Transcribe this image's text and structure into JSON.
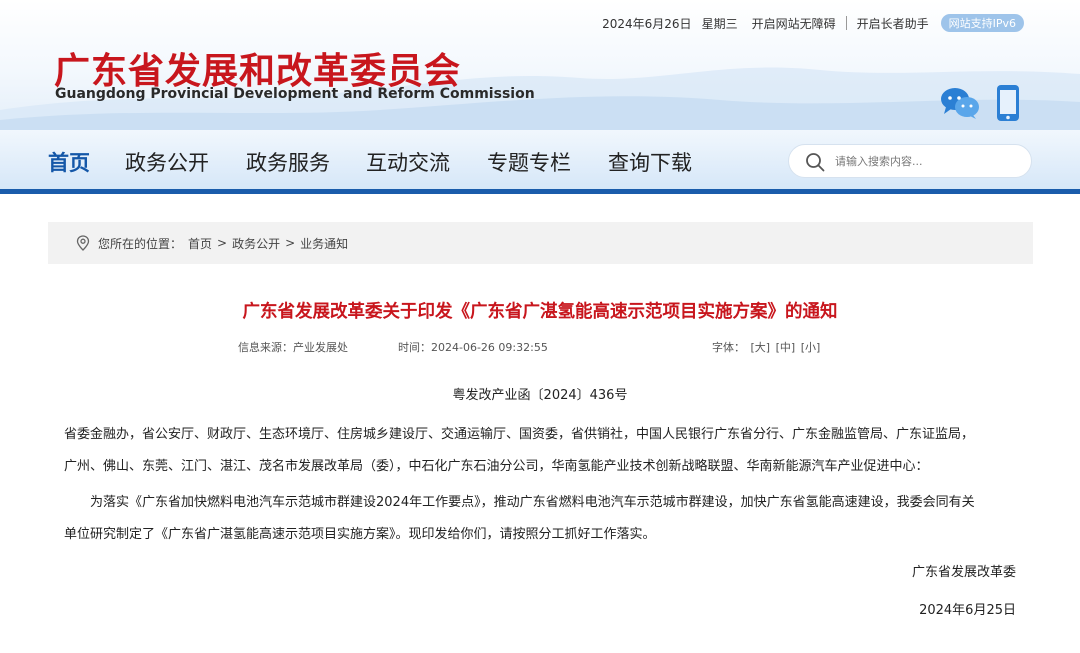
{
  "topbar": {
    "date": "2024年6月26日",
    "weekday": "星期三",
    "accessibility_label": "开启网站无障碍",
    "elder_label": "开启长者助手",
    "ipv6_label": "网站支持IPv6"
  },
  "brand": {
    "name_cn": "广东省发展和改革委员会",
    "name_en": "Guangdong Provincial Development and Reform Commission"
  },
  "nav": {
    "items": [
      "首页",
      "政务公开",
      "政务服务",
      "互动交流",
      "专题专栏",
      "查询下载"
    ]
  },
  "search": {
    "placeholder": "请输入搜索内容..."
  },
  "breadcrumb": {
    "prefix": "您所在的位置：",
    "items": [
      "首页",
      "政务公开",
      "业务通知"
    ],
    "separator": ">"
  },
  "article": {
    "title": "广东省发展改革委关于印发《广东省广湛氢能高速示范项目实施方案》的通知",
    "source": "信息来源：产业发展处",
    "time": "时间：2024-06-26 09:32:55",
    "font_label": "字体：",
    "font_sizes": [
      "[大]",
      "[中]",
      "[小]"
    ],
    "doc_number": "粤发改产业函〔2024〕436号",
    "recipients_line1": "省委金融办，省公安厅、财政厅、生态环境厅、住房城乡建设厅、交通运输厅、国资委，省供销社，中国人民银行广东省分行、广东金融监管局、广东证监局，",
    "recipients_line2": "广州、佛山、东莞、江门、湛江、茂名市发展改革局（委），中石化广东石油分公司，华南氢能产业技术创新战略联盟、华南新能源汽车产业促进中心：",
    "body_line1": "为落实《广东省加快燃料电池汽车示范城市群建设2024年工作要点》，推动广东省燃料电池汽车示范城市群建设，加快广东省氢能高速建设，我委会同有关",
    "body_line2": "单位研究制定了《广东省广湛氢能高速示范项目实施方案》。现印发给你们，请按照分工抓好工作落实。",
    "signature": "广东省发展改革委",
    "sign_date": "2024年6月25日"
  },
  "colors": {
    "brand_red": "#c8161d",
    "nav_blue": "#1a5cab"
  }
}
